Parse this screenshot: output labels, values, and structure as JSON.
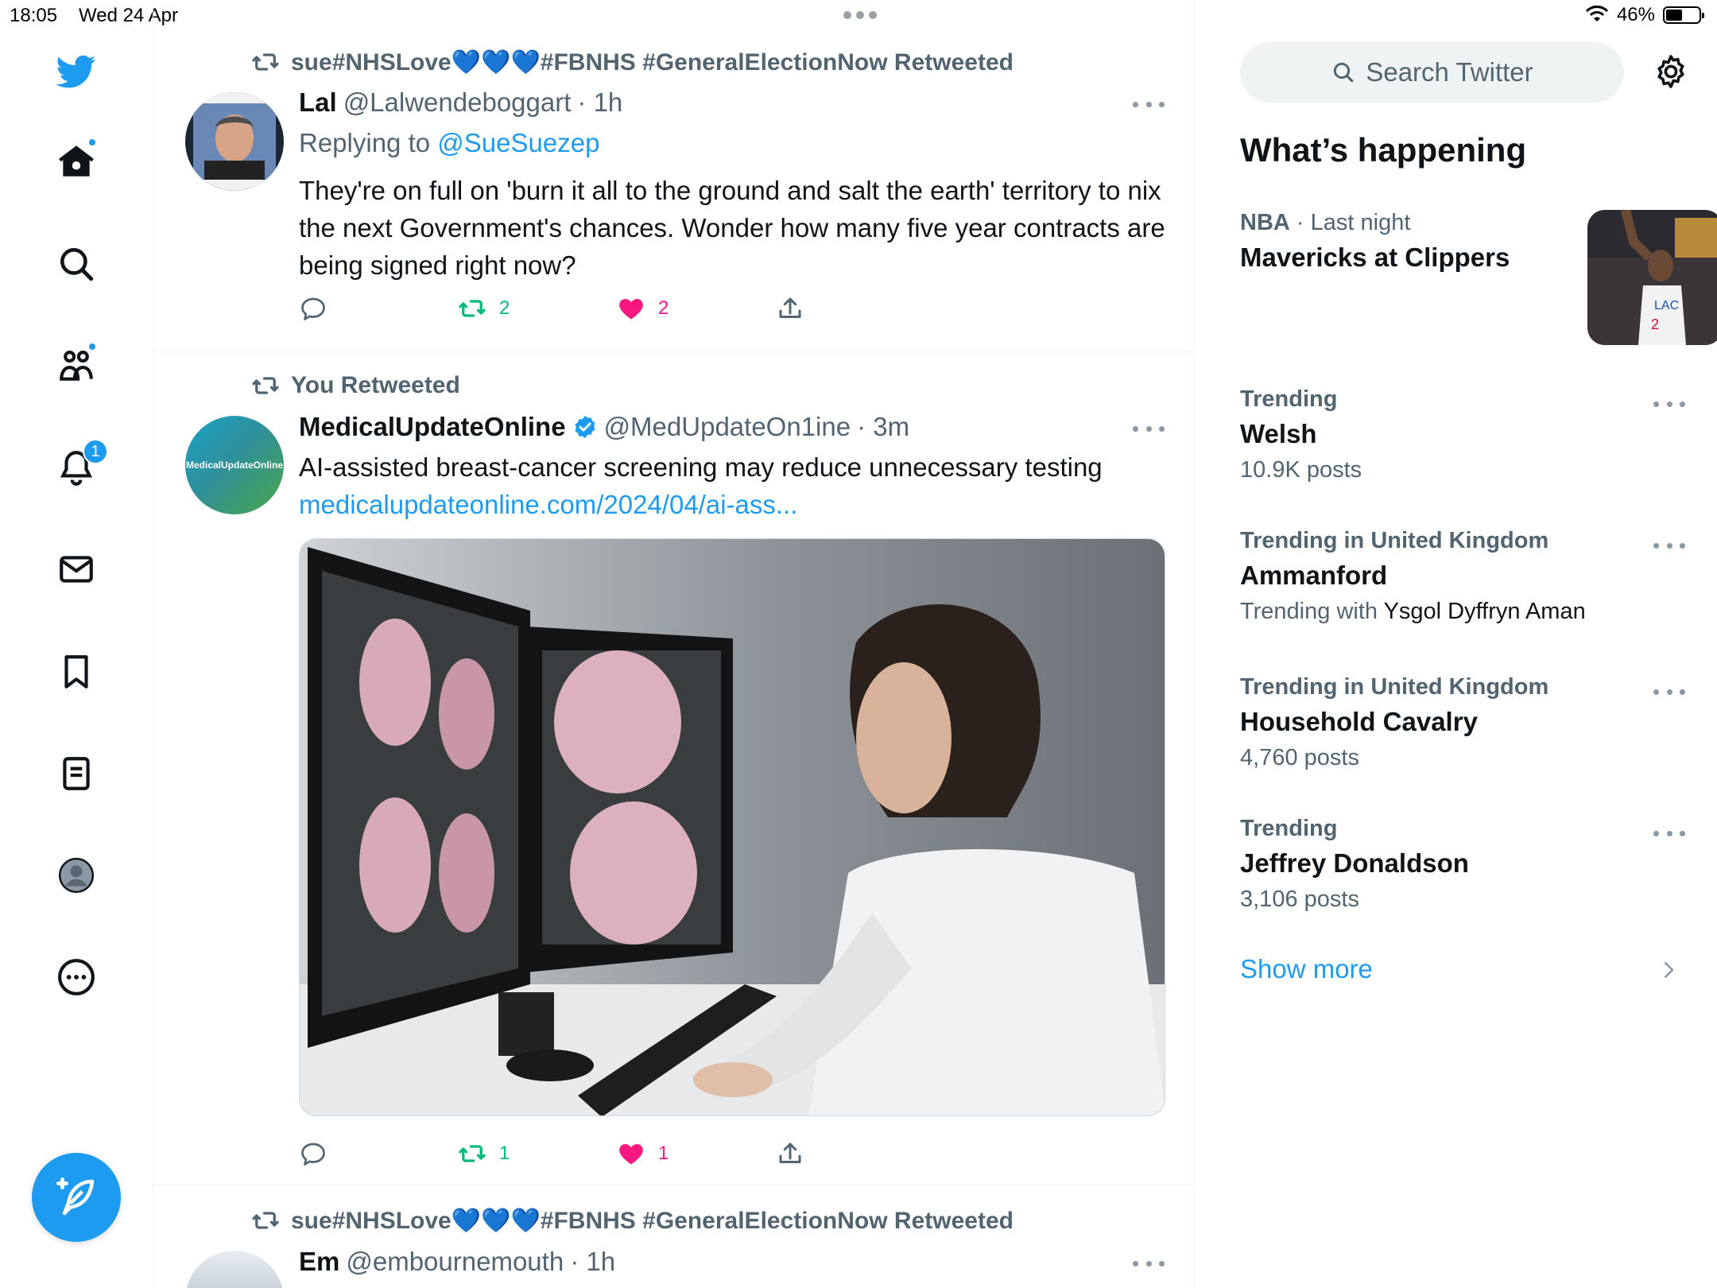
{
  "status_bar": {
    "time": "18:05",
    "date": "Wed 24 Apr",
    "battery": "46%"
  },
  "nav": {
    "notifications_badge": "1",
    "items": [
      "twitter-logo",
      "home",
      "explore",
      "communities",
      "notifications",
      "messages",
      "bookmarks",
      "lists",
      "profile",
      "more"
    ]
  },
  "tweets": [
    {
      "retweeted_by": "sue#NHSLove💙💙💙#FBNHS #GeneralElectionNow Retweeted",
      "name": "Lal",
      "handle": "@Lalwendeboggart",
      "time": "· 1h",
      "replying_label": "Replying to",
      "replying_to": "@SueSuezep",
      "text": "They're on full on 'burn it all to the ground and salt the earth' territory to nix the next Government's chances. Wonder how many five year contracts are being signed right now?",
      "retweets": "2",
      "likes": "2"
    },
    {
      "retweeted_by": "You Retweeted",
      "name": "MedicalUpdateOnline",
      "handle": "@MedUpdateOn1ine",
      "time": "· 3m",
      "avatar_text": "MedicalUpdateOnline",
      "text": "AI-assisted breast-cancer screening may reduce unnecessary testing",
      "link": "medicalupdateonline.com/2024/04/ai-ass...",
      "retweets": "1",
      "likes": "1"
    },
    {
      "retweeted_by": "sue#NHSLove💙💙💙#FBNHS #GeneralElectionNow Retweeted",
      "name": "Em",
      "handle": "@embournemouth",
      "time": "· 1h"
    }
  ],
  "sidebar": {
    "search_placeholder": "Search Twitter",
    "title": "What’s happening",
    "trends": [
      {
        "category": "NBA",
        "when": "· Last night",
        "title": "Mavericks at Clippers"
      },
      {
        "category": "Trending",
        "title": "Welsh",
        "count": "10.9K posts"
      },
      {
        "category": "Trending in United Kingdom",
        "title": "Ammanford",
        "with_label": "Trending with",
        "with_value": "Ysgol Dyffryn Aman"
      },
      {
        "category": "Trending in United Kingdom",
        "title": "Household Cavalry",
        "count": "4,760 posts"
      },
      {
        "category": "Trending",
        "title": "Jeffrey Donaldson",
        "count": "3,106 posts"
      }
    ],
    "show_more": "Show more"
  },
  "colors": {
    "accent": "#1d9bf0",
    "retweet": "#00ba7c",
    "like": "#f91880",
    "muted": "#536471"
  }
}
